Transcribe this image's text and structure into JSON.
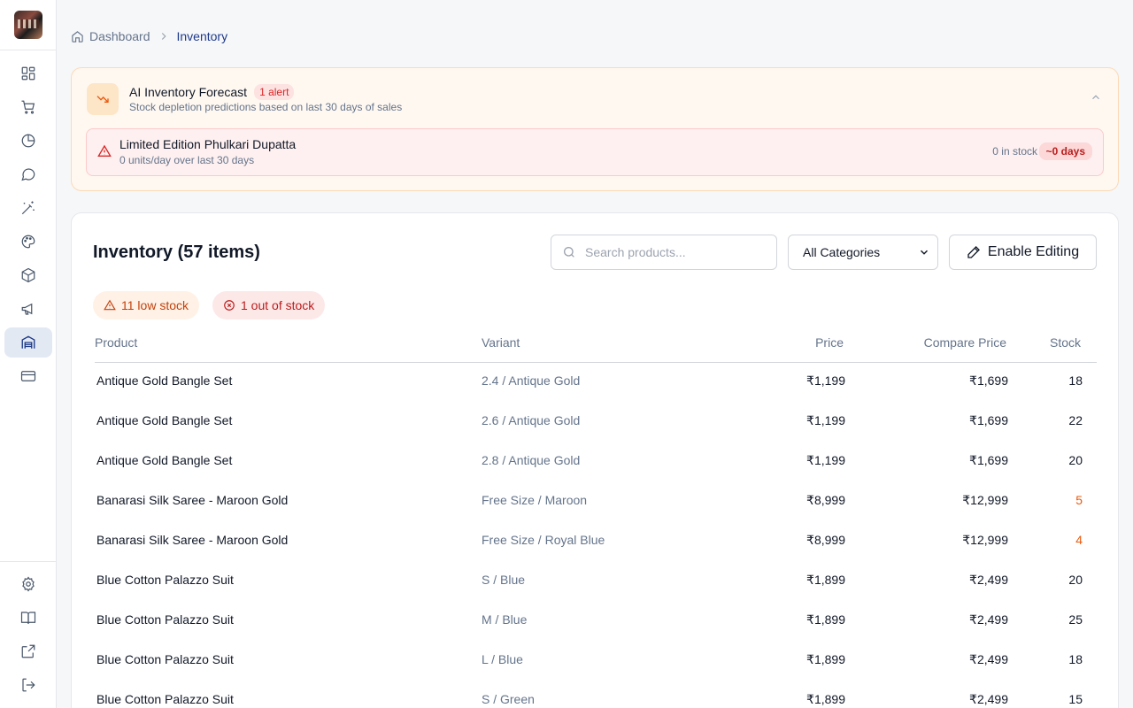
{
  "sidebar": {
    "items": [
      {
        "name": "sidebar-item-dashboard",
        "icon": "layout-dashboard-icon"
      },
      {
        "name": "sidebar-item-orders",
        "icon": "shopping-cart-icon"
      },
      {
        "name": "sidebar-item-analytics",
        "icon": "pie-chart-icon"
      },
      {
        "name": "sidebar-item-messages",
        "icon": "message-circle-icon"
      },
      {
        "name": "sidebar-item-ai-tools",
        "icon": "magic-wand-icon"
      },
      {
        "name": "sidebar-item-theme",
        "icon": "palette-icon"
      },
      {
        "name": "sidebar-item-products",
        "icon": "package-icon"
      },
      {
        "name": "sidebar-item-marketing",
        "icon": "megaphone-icon"
      },
      {
        "name": "sidebar-item-inventory",
        "icon": "warehouse-icon",
        "active": true
      },
      {
        "name": "sidebar-item-billing",
        "icon": "credit-card-icon"
      }
    ],
    "bottom_items": [
      {
        "name": "sidebar-item-settings",
        "icon": "gear-icon"
      },
      {
        "name": "sidebar-item-docs",
        "icon": "book-open-icon"
      },
      {
        "name": "sidebar-item-view-store",
        "icon": "external-link-icon"
      },
      {
        "name": "sidebar-item-logout",
        "icon": "log-out-icon"
      }
    ]
  },
  "breadcrumb": {
    "home": "Dashboard",
    "current": "Inventory"
  },
  "forecast": {
    "title": "AI Inventory Forecast",
    "badge": "1 alert",
    "subtitle": "Stock depletion predictions based on last 30 days of sales",
    "alert": {
      "product": "Limited Edition Phulkari Dupatta",
      "rate": "0 units/day over last 30 days",
      "stock": "0 in stock",
      "days": "~0 days"
    }
  },
  "inventory": {
    "title": "Inventory (57 items)",
    "search_placeholder": "Search products...",
    "category_selected": "All Categories",
    "edit_label": "Enable Editing",
    "low_stock_label": "11 low stock",
    "out_of_stock_label": "1 out of stock",
    "columns": {
      "product": "Product",
      "variant": "Variant",
      "price": "Price",
      "compare": "Compare Price",
      "stock": "Stock"
    },
    "rows": [
      {
        "product": "Antique Gold Bangle Set",
        "variant": "2.4 / Antique Gold",
        "price": "₹1,199",
        "compare": "₹1,699",
        "stock": "18",
        "low": false
      },
      {
        "product": "Antique Gold Bangle Set",
        "variant": "2.6 / Antique Gold",
        "price": "₹1,199",
        "compare": "₹1,699",
        "stock": "22",
        "low": false
      },
      {
        "product": "Antique Gold Bangle Set",
        "variant": "2.8 / Antique Gold",
        "price": "₹1,199",
        "compare": "₹1,699",
        "stock": "20",
        "low": false
      },
      {
        "product": "Banarasi Silk Saree - Maroon Gold",
        "variant": "Free Size / Maroon",
        "price": "₹8,999",
        "compare": "₹12,999",
        "stock": "5",
        "low": true
      },
      {
        "product": "Banarasi Silk Saree - Maroon Gold",
        "variant": "Free Size / Royal Blue",
        "price": "₹8,999",
        "compare": "₹12,999",
        "stock": "4",
        "low": true
      },
      {
        "product": "Blue Cotton Palazzo Suit",
        "variant": "S / Blue",
        "price": "₹1,899",
        "compare": "₹2,499",
        "stock": "20",
        "low": false
      },
      {
        "product": "Blue Cotton Palazzo Suit",
        "variant": "M / Blue",
        "price": "₹1,899",
        "compare": "₹2,499",
        "stock": "25",
        "low": false
      },
      {
        "product": "Blue Cotton Palazzo Suit",
        "variant": "L / Blue",
        "price": "₹1,899",
        "compare": "₹2,499",
        "stock": "18",
        "low": false
      },
      {
        "product": "Blue Cotton Palazzo Suit",
        "variant": "S / Green",
        "price": "₹1,899",
        "compare": "₹2,499",
        "stock": "15",
        "low": false
      }
    ]
  },
  "colors": {
    "accent": "#1e3a8a",
    "low_stock": "#ea580c",
    "danger": "#dc2626"
  }
}
